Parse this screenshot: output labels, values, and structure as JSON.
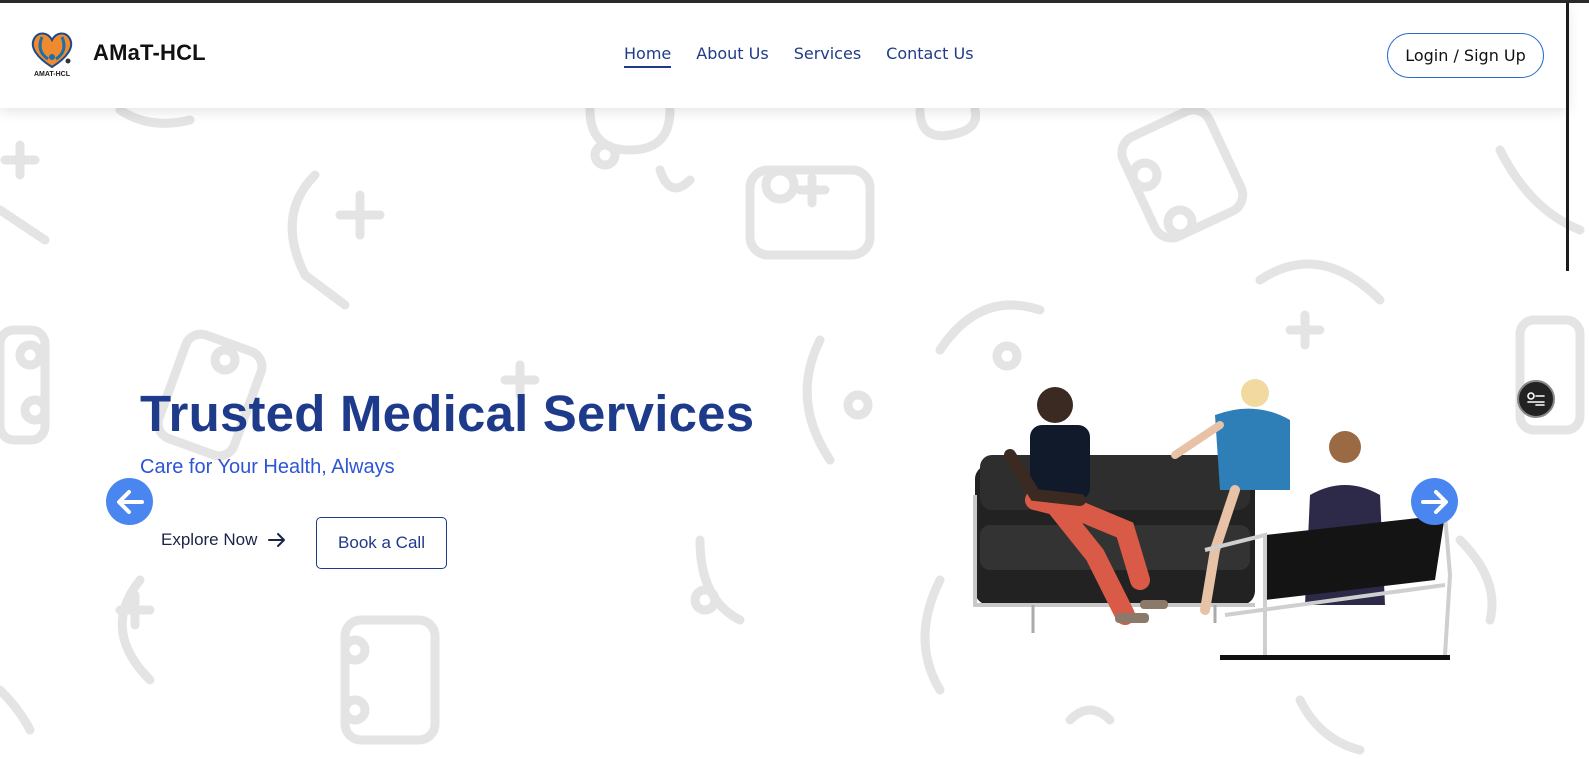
{
  "brand": {
    "name": "AMaT-HCL",
    "logo_icon": "heart-stethoscope-logo-icon"
  },
  "nav": {
    "items": [
      {
        "label": "Home",
        "active": true
      },
      {
        "label": "About Us",
        "active": false
      },
      {
        "label": "Services",
        "active": false
      },
      {
        "label": "Contact Us",
        "active": false
      }
    ],
    "login_label": "Login / Sign Up"
  },
  "hero": {
    "title": "Trusted Medical Services",
    "subtitle": "Care for Your Health, Always",
    "explore_label": "Explore Now",
    "book_label": "Book a Call",
    "image_icon": "people-consultation-photo"
  },
  "carousel": {
    "prev_icon": "arrow-left-icon",
    "next_icon": "arrow-right-icon"
  },
  "widget": {
    "icon": "settings-toggle-icon"
  },
  "colors": {
    "primary": "#1e3a8a",
    "accent": "#2d55d6",
    "arrow": "#4a86f0",
    "pattern": "#e6e6e6"
  }
}
